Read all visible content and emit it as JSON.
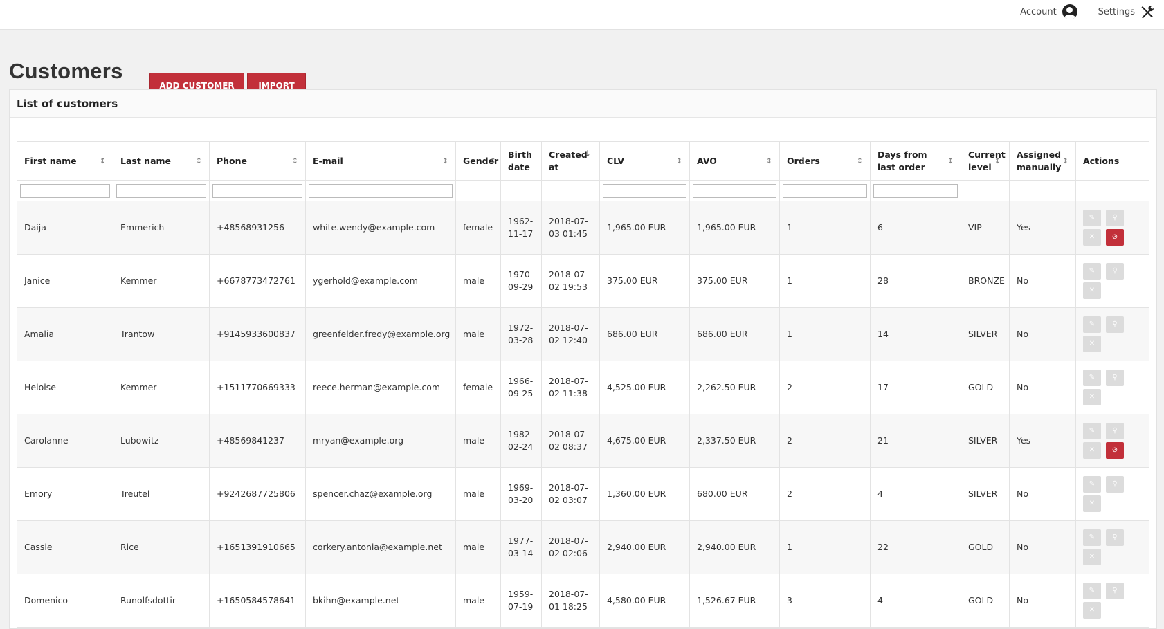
{
  "topbar": {
    "account_label": "Account",
    "settings_label": "Settings"
  },
  "page": {
    "title": "Customers",
    "add_button": "ADD CUSTOMER",
    "import_button": "IMPORT"
  },
  "panel": {
    "title": "List of customers"
  },
  "columns": [
    "First name",
    "Last name",
    "Phone",
    "E-mail",
    "Gender",
    "Birth date",
    "Created at",
    "CLV",
    "AVO",
    "Orders",
    "Days from last order",
    "Current level",
    "Assigned manually",
    "Actions"
  ],
  "rows": [
    {
      "first": "Daija",
      "last": "Emmerich",
      "phone": "+48568931256",
      "email": "white.wendy@example.com",
      "gender": "female",
      "birth": "1962-11-17",
      "created": "2018-07-03 01:45",
      "clv": "1,965.00  EUR",
      "avo": "1,965.00  EUR",
      "orders": "1",
      "days": "6",
      "level": "VIP",
      "manual": "Yes"
    },
    {
      "first": "Janice",
      "last": "Kemmer",
      "phone": "+6678773472761",
      "email": "ygerhold@example.com",
      "gender": "male",
      "birth": "1970-09-29",
      "created": "2018-07-02 19:53",
      "clv": "375.00  EUR",
      "avo": "375.00  EUR",
      "orders": "1",
      "days": "28",
      "level": "BRONZE",
      "manual": "No"
    },
    {
      "first": "Amalia",
      "last": "Trantow",
      "phone": "+9145933600837",
      "email": "greenfelder.fredy@example.org",
      "gender": "male",
      "birth": "1972-03-28",
      "created": "2018-07-02 12:40",
      "clv": "686.00  EUR",
      "avo": "686.00  EUR",
      "orders": "1",
      "days": "14",
      "level": "SILVER",
      "manual": "No"
    },
    {
      "first": "Heloise",
      "last": "Kemmer",
      "phone": "+1511770669333",
      "email": "reece.herman@example.com",
      "gender": "female",
      "birth": "1966-09-25",
      "created": "2018-07-02 11:38",
      "clv": "4,525.00  EUR",
      "avo": "2,262.50  EUR",
      "orders": "2",
      "days": "17",
      "level": "GOLD",
      "manual": "No"
    },
    {
      "first": "Carolanne",
      "last": "Lubowitz",
      "phone": "+48569841237",
      "email": "mryan@example.org",
      "gender": "male",
      "birth": "1982-02-24",
      "created": "2018-07-02 08:37",
      "clv": "4,675.00  EUR",
      "avo": "2,337.50  EUR",
      "orders": "2",
      "days": "21",
      "level": "SILVER",
      "manual": "Yes"
    },
    {
      "first": "Emory",
      "last": "Treutel",
      "phone": "+9242687725806",
      "email": "spencer.chaz@example.org",
      "gender": "male",
      "birth": "1969-03-20",
      "created": "2018-07-02 03:07",
      "clv": "1,360.00  EUR",
      "avo": "680.00  EUR",
      "orders": "2",
      "days": "4",
      "level": "SILVER",
      "manual": "No"
    },
    {
      "first": "Cassie",
      "last": "Rice",
      "phone": "+1651391910665",
      "email": "corkery.antonia@example.net",
      "gender": "male",
      "birth": "1977-03-14",
      "created": "2018-07-02 02:06",
      "clv": "2,940.00  EUR",
      "avo": "2,940.00  EUR",
      "orders": "1",
      "days": "22",
      "level": "GOLD",
      "manual": "No"
    },
    {
      "first": "Domenico",
      "last": "Runolfsdottir",
      "phone": "+1650584578641",
      "email": "bkihn@example.net",
      "gender": "male",
      "birth": "1959-07-19",
      "created": "2018-07-01 18:25",
      "clv": "4,580.00  EUR",
      "avo": "1,526.67  EUR",
      "orders": "3",
      "days": "4",
      "level": "GOLD",
      "manual": "No"
    }
  ],
  "icons": {
    "edit": "pencil-icon",
    "view": "search-icon",
    "remove": "close-icon",
    "unassign": "unlink-icon",
    "sort": "sort-icon"
  },
  "colors": {
    "accent": "#c2303a",
    "action_gray": "#dcdcdc"
  }
}
